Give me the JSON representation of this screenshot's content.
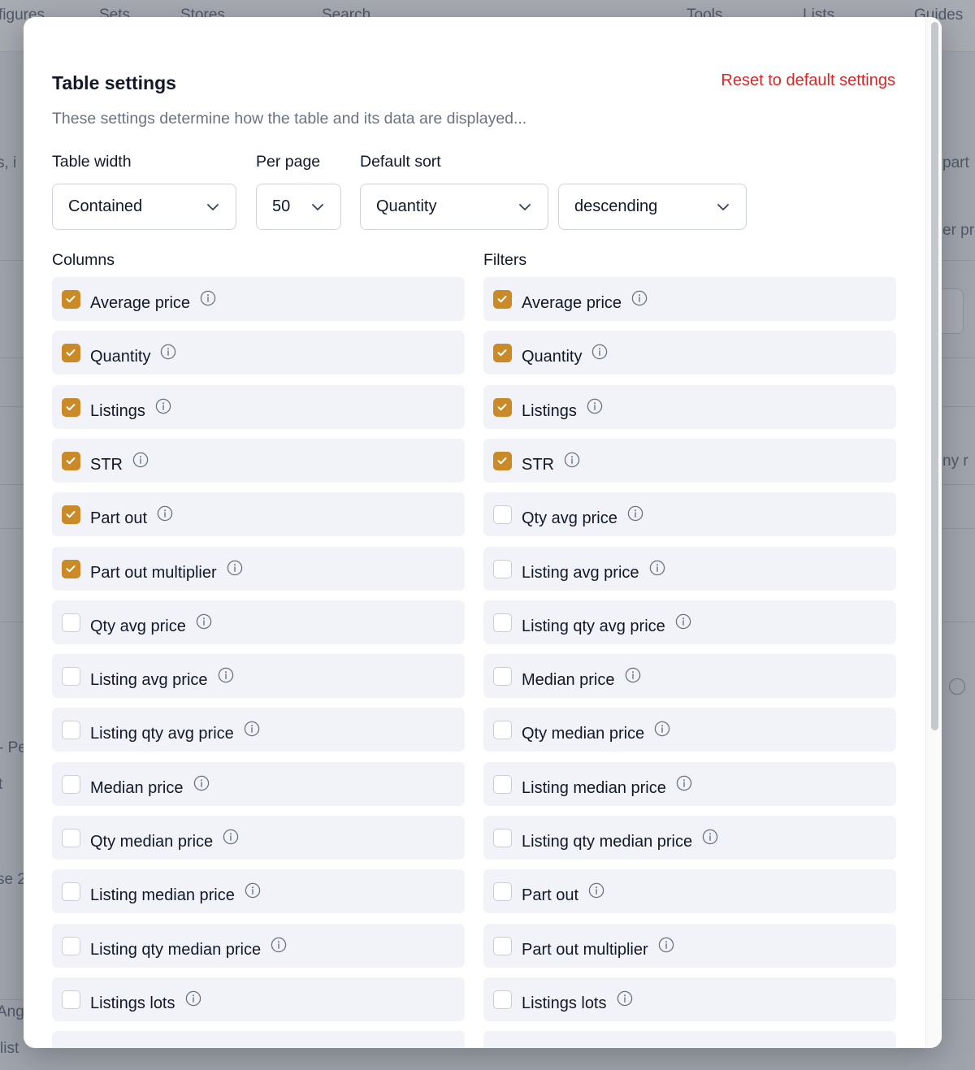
{
  "background": {
    "nav": [
      "figures",
      "Sets",
      "Stores",
      "Search",
      "Tools",
      "Lists",
      "Guides"
    ],
    "fragments": [
      "s, i",
      "part",
      "er pr",
      "ny r",
      "- Pe",
      "t",
      "se 2",
      "Ang",
      "list"
    ]
  },
  "modal": {
    "title": "Table settings",
    "reset_label": "Reset to default settings",
    "description": "These settings determine how the table and its data are displayed...",
    "table_width": {
      "label": "Table width",
      "value": "Contained"
    },
    "per_page": {
      "label": "Per page",
      "value": "50"
    },
    "default_sort": {
      "label": "Default sort",
      "value": "Quantity",
      "direction": "descending"
    },
    "columns": {
      "heading": "Columns",
      "items": [
        {
          "label": "Average price",
          "checked": true
        },
        {
          "label": "Quantity",
          "checked": true
        },
        {
          "label": "Listings",
          "checked": true
        },
        {
          "label": "STR",
          "checked": true
        },
        {
          "label": "Part out",
          "checked": true
        },
        {
          "label": "Part out multiplier",
          "checked": true
        },
        {
          "label": "Qty avg price",
          "checked": false
        },
        {
          "label": "Listing avg price",
          "checked": false
        },
        {
          "label": "Listing qty avg price",
          "checked": false
        },
        {
          "label": "Median price",
          "checked": false
        },
        {
          "label": "Qty median price",
          "checked": false
        },
        {
          "label": "Listing median price",
          "checked": false
        },
        {
          "label": "Listing qty median price",
          "checked": false
        },
        {
          "label": "Listings lots",
          "checked": false
        }
      ]
    },
    "filters": {
      "heading": "Filters",
      "items": [
        {
          "label": "Average price",
          "checked": true
        },
        {
          "label": "Quantity",
          "checked": true
        },
        {
          "label": "Listings",
          "checked": true
        },
        {
          "label": "STR",
          "checked": true
        },
        {
          "label": "Qty avg price",
          "checked": false
        },
        {
          "label": "Listing avg price",
          "checked": false
        },
        {
          "label": "Listing qty avg price",
          "checked": false
        },
        {
          "label": "Median price",
          "checked": false
        },
        {
          "label": "Qty median price",
          "checked": false
        },
        {
          "label": "Listing median price",
          "checked": false
        },
        {
          "label": "Listing qty median price",
          "checked": false
        },
        {
          "label": "Part out",
          "checked": false
        },
        {
          "label": "Part out multiplier",
          "checked": false
        },
        {
          "label": "Listings lots",
          "checked": false
        }
      ]
    }
  },
  "colors": {
    "accent": "#c98a27",
    "reset": "#dc2626",
    "row_bg": "#f1f3f8"
  }
}
